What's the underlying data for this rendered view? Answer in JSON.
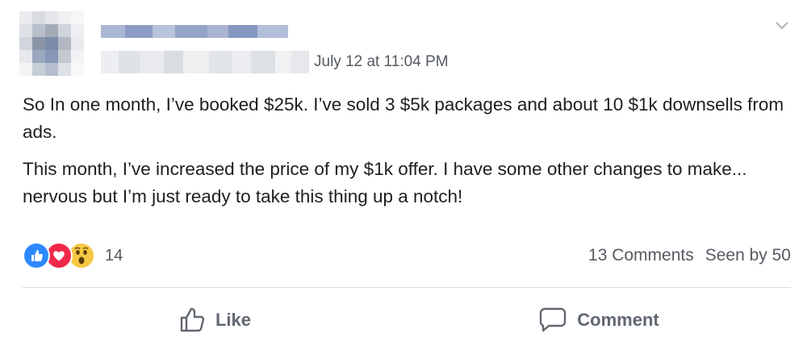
{
  "post": {
    "author": {
      "name": "",
      "avatar": "blurred-avatar"
    },
    "timestamp": "July 12 at 11:04 PM",
    "paragraphs": [
      "So In one month, I’ve booked $25k. I’ve sold 3 $5k packages and about 10 $1k downsells from ads.",
      "This month, I’ve increased the price of my $1k offer. I have some other changes to make... nervous but I’m just ready to take this thing up a notch!"
    ],
    "reactions": {
      "types": [
        "like-icon",
        "love-icon",
        "wow-icon"
      ],
      "count": "14"
    },
    "stats": {
      "comments": "13 Comments",
      "seen_by": "Seen by 50"
    },
    "actions": {
      "like_label": "Like",
      "comment_label": "Comment"
    },
    "colors": {
      "like": "#2d88ff",
      "love": "#f0284a",
      "wow": "#f7c842",
      "secondary_text": "#606770"
    }
  }
}
